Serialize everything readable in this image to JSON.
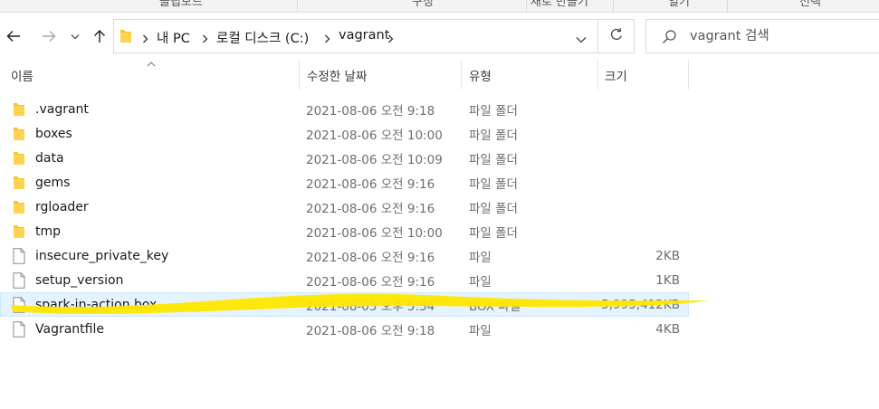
{
  "ribbon": {
    "groups": [
      "클립보드",
      "구성",
      "새로 만들기",
      "열기",
      "선택"
    ]
  },
  "nav": {
    "back_icon": "arrow-left-icon",
    "forward_icon": "arrow-right-icon",
    "recent_icon": "chevron-down-icon",
    "up_icon": "arrow-up-icon",
    "refresh_icon": "refresh-icon"
  },
  "breadcrumb": {
    "items": [
      "내 PC",
      "로컬 디스크 (C:)",
      "vagrant"
    ]
  },
  "search": {
    "placeholder": "vagrant 검색"
  },
  "columns": {
    "name": "이름",
    "date": "수정한 날짜",
    "type": "유형",
    "size": "크기"
  },
  "files": [
    {
      "name": ".vagrant",
      "date": "2021-08-06 오전 9:18",
      "type": "파일 폴더",
      "size": "",
      "kind": "folder"
    },
    {
      "name": "boxes",
      "date": "2021-08-06 오전 10:00",
      "type": "파일 폴더",
      "size": "",
      "kind": "folder"
    },
    {
      "name": "data",
      "date": "2021-08-06 오전 10:09",
      "type": "파일 폴더",
      "size": "",
      "kind": "folder"
    },
    {
      "name": "gems",
      "date": "2021-08-06 오전 9:16",
      "type": "파일 폴더",
      "size": "",
      "kind": "folder"
    },
    {
      "name": "rgloader",
      "date": "2021-08-06 오전 9:16",
      "type": "파일 폴더",
      "size": "",
      "kind": "folder"
    },
    {
      "name": "tmp",
      "date": "2021-08-06 오전 10:00",
      "type": "파일 폴더",
      "size": "",
      "kind": "folder"
    },
    {
      "name": "insecure_private_key",
      "date": "2021-08-06 오전 9:16",
      "type": "파일",
      "size": "2KB",
      "kind": "file"
    },
    {
      "name": "setup_version",
      "date": "2021-08-06 오전 9:16",
      "type": "파일",
      "size": "1KB",
      "kind": "file"
    },
    {
      "name": "spark-in-action.box",
      "date": "2021-08-05 오후 5:54",
      "type": "BOX 파일",
      "size": "5,995,412KB",
      "kind": "file",
      "selected": true
    },
    {
      "name": "Vagrantfile",
      "date": "2021-08-06 오전 9:18",
      "type": "파일",
      "size": "4KB",
      "kind": "file"
    }
  ],
  "colors": {
    "folder": "#f4c430",
    "selection": "#e5f3ff",
    "highlighter": "#ffe600"
  }
}
